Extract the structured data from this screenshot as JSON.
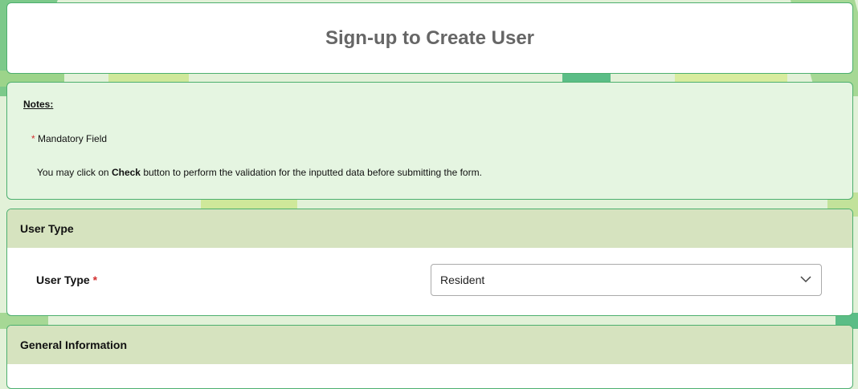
{
  "page": {
    "title": "Sign-up to Create User"
  },
  "notes": {
    "heading": "Notes:",
    "mandatory_marker": "*",
    "mandatory_text": "Mandatory Field",
    "check_prefix": "You may click on",
    "check_button_name": "Check",
    "check_suffix": "button to perform the validation for the inputted data before submitting the form."
  },
  "user_type_section": {
    "header": "User Type",
    "field_label": "User Type",
    "required_marker": "*",
    "selected_value": "Resident",
    "dropdown_icon": "chevron-down-icon"
  },
  "general_section": {
    "header": "General Information"
  },
  "colors": {
    "card_border": "#4caf6e",
    "notes_bg": "#e5f5e1",
    "section_header_bg": "#d6e3bf",
    "required": "#d32f2f",
    "title_text": "#666666"
  }
}
